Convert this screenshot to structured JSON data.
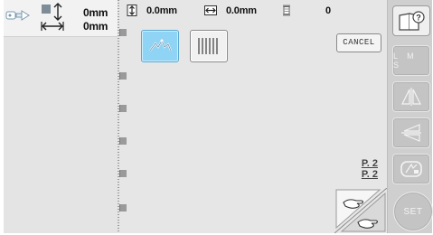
{
  "size_info": {
    "width_value": "0mm",
    "height_value": "0mm"
  },
  "top_bar": {
    "vertical_value": "0.0mm",
    "horizontal_value": "0.0mm",
    "thread_count": "0"
  },
  "buttons": {
    "cancel_label": "CANCEL",
    "side_button_label": "L M S",
    "set_label": "SET"
  },
  "pagination": {
    "current": "P. 2",
    "total": "P. 2"
  },
  "icons": {
    "preview": "machine-preview-icon",
    "size": "size-arrows-icon",
    "height": "vertical-arrows-icon",
    "width": "horizontal-arrows-icon",
    "thread": "thread-spool-icon",
    "stitch_pattern": "stitch-pattern-icon",
    "straight_stitch": "straight-stitch-icon",
    "help": "help-book-icon",
    "mirror": "mirror-horizontal-icon",
    "rotate": "rotate-icon",
    "density": "density-icon",
    "page_flip": "page-flip-hand-icon"
  },
  "colors": {
    "active_button": "#8fd3f5",
    "background": "#e3e3e3"
  }
}
